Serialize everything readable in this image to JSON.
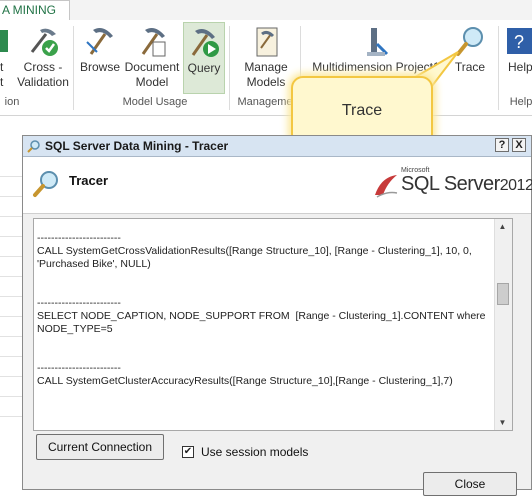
{
  "ribbon": {
    "active_tab": "A MINING",
    "buttons": [
      {
        "label": "t\nt"
      },
      {
        "label": "Cross -\nValidation"
      },
      {
        "label": "Browse"
      },
      {
        "label": "Document\nModel"
      },
      {
        "label": "Query"
      },
      {
        "label": "Manage\nModels"
      },
      {
        "label": "Multidimension Project1"
      },
      {
        "label": "Trace"
      },
      {
        "label": "Help"
      }
    ],
    "groups": [
      "ion",
      "Model Usage",
      "Manageme",
      "Help"
    ]
  },
  "callout": {
    "text": "Trace"
  },
  "dialog": {
    "title": "SQL Server Data Mining - Tracer",
    "help_button": "?",
    "close_button": "X",
    "header_title": "Tracer",
    "logo": {
      "microsoft": "Microsoft",
      "product": "SQL Server",
      "year": "2012"
    },
    "log_lines": [
      "",
      "------------------------",
      "CALL SystemGetCrossValidationResults([Range Structure_10], [Range - Clustering_1], 10, 0, 'Purchased Bike', NULL)",
      "",
      "",
      "------------------------",
      "SELECT NODE_CAPTION, NODE_SUPPORT FROM  [Range - Clustering_1].CONTENT where NODE_TYPE=5",
      "",
      "",
      "------------------------",
      "CALL SystemGetClusterAccuracyResults([Range Structure_10],[Range - Clustering_1],7)"
    ],
    "current_connection_button": "Current Connection",
    "use_session_models_label": "Use session models",
    "use_session_models_checked": true,
    "close_label": "Close"
  }
}
